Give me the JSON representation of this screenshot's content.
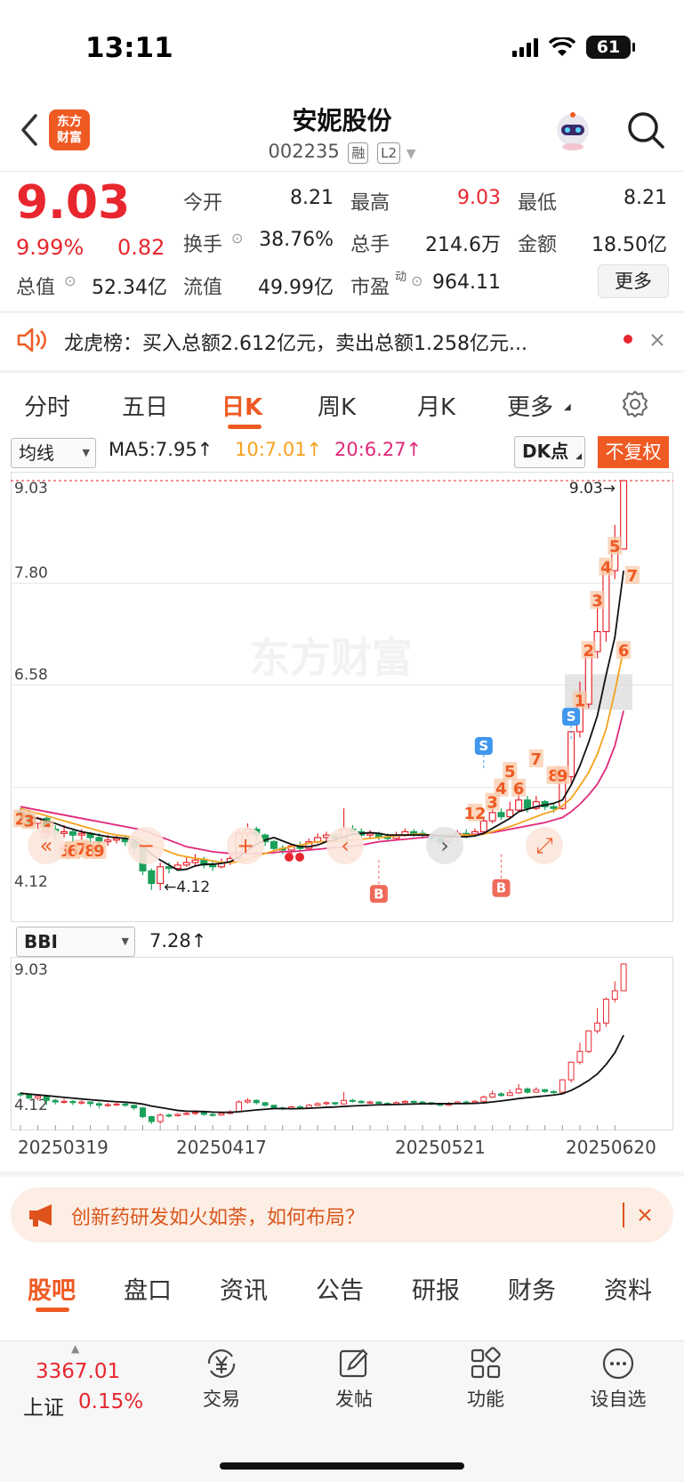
{
  "status": {
    "time": "13:11",
    "battery": "61"
  },
  "header": {
    "logo_line1": "东方",
    "logo_line2": "财富",
    "name": "安妮股份",
    "code": "002235",
    "tag1": "融",
    "tag2": "L2"
  },
  "quote": {
    "price": "9.03",
    "pct": "9.99%",
    "change": "0.82",
    "open_label": "今开",
    "open": "8.21",
    "high_label": "最高",
    "high": "9.03",
    "low_label": "最低",
    "low": "8.21",
    "turnover_label": "换手",
    "turnover": "38.76%",
    "volume_label": "总手",
    "volume": "214.6万",
    "amount_label": "金额",
    "amount": "18.50亿",
    "mktcap_label": "总值",
    "mktcap": "52.34亿",
    "float_label": "流值",
    "float": "49.99亿",
    "pe_label": "市盈",
    "pe_sup": "动",
    "pe": "964.11",
    "more": "更多"
  },
  "banner": {
    "text": "龙虎榜：买入总额2.612亿元，卖出总额1.258亿元..."
  },
  "period_tabs": [
    "分时",
    "五日",
    "日K",
    "周K",
    "月K",
    "更多"
  ],
  "chart_controls": {
    "indicator": "均线",
    "ma5": "MA5:7.95↑",
    "ma10": "10:7.01↑",
    "ma20": "20:6.27↑",
    "dk": "DK点",
    "fq": "不复权",
    "sub_indicator": "BBI",
    "bbi_value": "7.28↑"
  },
  "chart_data": {
    "type": "candlestick",
    "main": {
      "y_ticks": [
        "9.03",
        "7.80",
        "6.58",
        "4.12"
      ],
      "ylim": [
        4.12,
        9.03
      ],
      "high_label": "9.03→",
      "low_label": "←4.12",
      "x_ticks": [
        "20250319",
        "20250417",
        "20250521",
        "20250620"
      ],
      "candles": [
        [
          5.05,
          5.02,
          5.1,
          4.95
        ],
        [
          5.02,
          4.92,
          5.05,
          4.88
        ],
        [
          4.92,
          4.98,
          5.0,
          4.85
        ],
        [
          4.98,
          4.85,
          5.0,
          4.7
        ],
        [
          4.85,
          4.8,
          4.9,
          4.72
        ],
        [
          4.8,
          4.82,
          4.9,
          4.75
        ],
        [
          4.82,
          4.78,
          4.86,
          4.7
        ],
        [
          4.78,
          4.8,
          4.85,
          4.72
        ],
        [
          4.8,
          4.75,
          4.82,
          4.65
        ],
        [
          4.75,
          4.7,
          4.8,
          4.6
        ],
        [
          4.7,
          4.72,
          4.78,
          4.65
        ],
        [
          4.72,
          4.74,
          4.78,
          4.68
        ],
        [
          4.74,
          4.7,
          4.76,
          4.65
        ],
        [
          4.7,
          4.62,
          4.72,
          4.55
        ],
        [
          4.62,
          4.35,
          4.65,
          4.3
        ],
        [
          4.35,
          4.2,
          4.38,
          4.12
        ],
        [
          4.2,
          4.4,
          4.45,
          4.12
        ],
        [
          4.4,
          4.38,
          4.45,
          4.32
        ],
        [
          4.38,
          4.42,
          4.46,
          4.35
        ],
        [
          4.42,
          4.45,
          4.52,
          4.4
        ],
        [
          4.45,
          4.48,
          4.55,
          4.4
        ],
        [
          4.48,
          4.42,
          4.52,
          4.38
        ],
        [
          4.42,
          4.4,
          4.48,
          4.35
        ],
        [
          4.4,
          4.45,
          4.5,
          4.38
        ],
        [
          4.45,
          4.5,
          4.55,
          4.42
        ],
        [
          4.5,
          4.8,
          4.85,
          4.48
        ],
        [
          4.8,
          4.85,
          4.92,
          4.75
        ],
        [
          4.85,
          4.78,
          4.88,
          4.72
        ],
        [
          4.78,
          4.7,
          4.8,
          4.65
        ],
        [
          4.7,
          4.62,
          4.72,
          4.58
        ],
        [
          4.62,
          4.6,
          4.66,
          4.55
        ],
        [
          4.6,
          4.65,
          4.68,
          4.56
        ],
        [
          4.65,
          4.62,
          4.7,
          4.58
        ],
        [
          4.62,
          4.7,
          4.74,
          4.6
        ],
        [
          4.7,
          4.75,
          4.8,
          4.68
        ],
        [
          4.75,
          4.78,
          4.82,
          4.7
        ],
        [
          4.78,
          4.74,
          4.8,
          4.7
        ],
        [
          4.74,
          4.85,
          5.1,
          4.72
        ],
        [
          4.85,
          4.82,
          4.9,
          4.78
        ],
        [
          4.82,
          4.78,
          4.86,
          4.75
        ],
        [
          4.78,
          4.8,
          4.84,
          4.74
        ],
        [
          4.8,
          4.76,
          4.82,
          4.72
        ],
        [
          4.76,
          4.74,
          4.8,
          4.7
        ],
        [
          4.74,
          4.78,
          4.82,
          4.72
        ],
        [
          4.78,
          4.82,
          4.86,
          4.76
        ],
        [
          4.82,
          4.8,
          4.85,
          4.76
        ],
        [
          4.8,
          4.78,
          4.84,
          4.74
        ],
        [
          4.78,
          4.74,
          4.8,
          4.7
        ],
        [
          4.74,
          4.7,
          4.76,
          4.66
        ],
        [
          4.7,
          4.76,
          4.8,
          4.68
        ],
        [
          4.76,
          4.8,
          4.84,
          4.74
        ],
        [
          4.8,
          4.78,
          4.85,
          4.74
        ],
        [
          4.78,
          4.82,
          4.86,
          4.76
        ],
        [
          4.82,
          4.95,
          5.0,
          4.8
        ],
        [
          4.95,
          5.05,
          5.15,
          4.92
        ],
        [
          5.05,
          5.0,
          5.1,
          4.96
        ],
        [
          5.0,
          5.08,
          5.18,
          4.98
        ],
        [
          5.08,
          5.2,
          5.35,
          5.05
        ],
        [
          5.2,
          5.1,
          5.25,
          5.05
        ],
        [
          5.1,
          5.18,
          5.25,
          5.08
        ],
        [
          5.18,
          5.12,
          5.2,
          5.08
        ],
        [
          5.12,
          5.1,
          5.16,
          5.05
        ],
        [
          5.1,
          5.48,
          5.5,
          5.08
        ],
        [
          5.48,
          6.02,
          6.03,
          5.4
        ],
        [
          6.02,
          6.35,
          6.62,
          5.95
        ],
        [
          6.35,
          6.98,
          7.0,
          6.3
        ],
        [
          6.98,
          7.22,
          7.68,
          6.9
        ],
        [
          7.22,
          7.95,
          8.0,
          7.1
        ],
        [
          7.95,
          8.21,
          8.5,
          7.85
        ],
        [
          8.21,
          9.03,
          9.03,
          8.21
        ]
      ],
      "ma5": [
        5.05,
        5.0,
        4.98,
        4.95,
        4.92,
        4.88,
        4.85,
        4.82,
        4.8,
        4.78,
        4.76,
        4.75,
        4.74,
        4.72,
        4.65,
        4.55,
        4.48,
        4.42,
        4.36,
        4.37,
        4.41,
        4.43,
        4.43,
        4.44,
        4.46,
        4.52,
        4.6,
        4.67,
        4.72,
        4.75,
        4.71,
        4.67,
        4.64,
        4.64,
        4.66,
        4.7,
        4.72,
        4.76,
        4.79,
        4.8,
        4.81,
        4.8,
        4.78,
        4.78,
        4.78,
        4.78,
        4.78,
        4.78,
        4.77,
        4.76,
        4.76,
        4.76,
        4.77,
        4.8,
        4.86,
        4.92,
        4.98,
        5.06,
        5.09,
        5.12,
        5.14,
        5.16,
        5.2,
        5.38,
        5.61,
        5.89,
        6.21,
        6.7,
        7.15,
        7.95
      ],
      "ma10": [
        5.1,
        5.07,
        5.04,
        5.01,
        4.98,
        4.95,
        4.92,
        4.89,
        4.86,
        4.83,
        4.8,
        4.78,
        4.77,
        4.75,
        4.71,
        4.65,
        4.62,
        4.58,
        4.54,
        4.52,
        4.5,
        4.49,
        4.47,
        4.45,
        4.45,
        4.46,
        4.49,
        4.53,
        4.56,
        4.59,
        4.62,
        4.64,
        4.66,
        4.68,
        4.7,
        4.7,
        4.7,
        4.71,
        4.72,
        4.73,
        4.74,
        4.75,
        4.76,
        4.77,
        4.78,
        4.79,
        4.79,
        4.78,
        4.78,
        4.78,
        4.78,
        4.78,
        4.78,
        4.79,
        4.82,
        4.85,
        4.88,
        4.92,
        4.96,
        5.0,
        5.04,
        5.07,
        5.13,
        5.22,
        5.37,
        5.53,
        5.75,
        6.05,
        6.5,
        7.01
      ],
      "ma20": [
        5.12,
        5.1,
        5.08,
        5.06,
        5.04,
        5.02,
        5.0,
        4.98,
        4.96,
        4.94,
        4.92,
        4.9,
        4.88,
        4.86,
        4.84,
        4.8,
        4.76,
        4.72,
        4.68,
        4.64,
        4.62,
        4.6,
        4.58,
        4.57,
        4.56,
        4.56,
        4.56,
        4.56,
        4.56,
        4.57,
        4.58,
        4.58,
        4.59,
        4.6,
        4.61,
        4.62,
        4.63,
        4.64,
        4.65,
        4.66,
        4.68,
        4.7,
        4.71,
        4.72,
        4.73,
        4.74,
        4.75,
        4.76,
        4.77,
        4.77,
        4.78,
        4.78,
        4.79,
        4.8,
        4.81,
        4.83,
        4.85,
        4.87,
        4.89,
        4.91,
        4.93,
        4.96,
        4.99,
        5.06,
        5.15,
        5.26,
        5.39,
        5.58,
        5.85,
        6.27
      ],
      "signals": [
        {
          "i": 53,
          "label": "S",
          "kind": "sell",
          "price": 5.55
        },
        {
          "i": 63,
          "label": "S",
          "kind": "sell",
          "price": 5.9
        },
        {
          "i": 41,
          "label": "B",
          "kind": "buy",
          "price": 4.48
        },
        {
          "i": 55,
          "label": "B",
          "kind": "buy",
          "price": 4.55
        }
      ],
      "td_numbers": [
        {
          "i": 0,
          "n": "2",
          "price": 4.98
        },
        {
          "i": 1,
          "n": "3",
          "price": 4.96
        },
        {
          "i": 3,
          "n": "4",
          "price": 4.85
        },
        {
          "i": 5,
          "n": "5",
          "price": 4.6
        },
        {
          "i": 6,
          "n": "6",
          "price": 4.6
        },
        {
          "i": 7,
          "n": "7",
          "price": 4.62
        },
        {
          "i": 8,
          "n": "8",
          "price": 4.6
        },
        {
          "i": 9,
          "n": "9",
          "price": 4.6
        },
        {
          "i": 52,
          "n": "12",
          "price": 5.05
        },
        {
          "i": 54,
          "n": "3",
          "price": 5.18
        },
        {
          "i": 55,
          "n": "4",
          "price": 5.35
        },
        {
          "i": 56,
          "n": "5",
          "price": 5.55
        },
        {
          "i": 57,
          "n": "6",
          "price": 5.35
        },
        {
          "i": 59,
          "n": "7",
          "price": 5.7
        },
        {
          "i": 61,
          "n": "8",
          "price": 5.5
        },
        {
          "i": 62,
          "n": "9",
          "price": 5.5
        },
        {
          "i": 64,
          "n": "1",
          "price": 6.4
        },
        {
          "i": 65,
          "n": "2",
          "price": 7.0
        },
        {
          "i": 66,
          "n": "3",
          "price": 7.6
        },
        {
          "i": 67,
          "n": "4",
          "price": 8.0
        },
        {
          "i": 68,
          "n": "5",
          "price": 8.25
        },
        {
          "i": 69,
          "n": "6",
          "price": 7.0
        },
        {
          "i": 70,
          "n": "7",
          "price": 7.9
        }
      ]
    },
    "sub": {
      "y_ticks": [
        "9.03",
        "4.12"
      ],
      "ylim": [
        4.12,
        9.03
      ]
    }
  },
  "chart_toolbar": [
    "prev-range",
    "zoom-out",
    "zoom-in",
    "prev-day",
    "next-day",
    "fullscreen"
  ],
  "promo": {
    "text": "创新药研发如火如荼，如何布局？"
  },
  "bottom_tabs": [
    "股吧",
    "盘口",
    "资讯",
    "公告",
    "研报",
    "财务",
    "资料"
  ],
  "bottom_nav": {
    "index_value": "3367.01",
    "index_name": "上证",
    "index_pct": "0.15%",
    "items": [
      "交易",
      "发帖",
      "功能",
      "设自选"
    ]
  },
  "colors": {
    "up": "#e8262e",
    "down": "#1aa05a",
    "accent": "#ef5a23",
    "ma5": "#111111",
    "ma10": "#f6a21c",
    "ma20": "#e0287a"
  }
}
